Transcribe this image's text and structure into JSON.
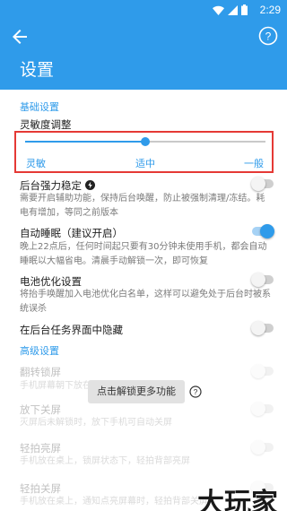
{
  "status_bar": {
    "time": "2:29",
    "icons": [
      "wifi-icon",
      "signal-icon",
      "battery-icon"
    ]
  },
  "app_bar": {
    "title": "设置",
    "back_icon": "arrow-back-icon",
    "help_icon": "help-circle-icon"
  },
  "basic_section": {
    "title": "基础设置",
    "sensitivity": {
      "title": "灵敏度调整",
      "labels": [
        "灵敏",
        "适中",
        "一般"
      ],
      "value_fraction": 0.5
    },
    "rows": [
      {
        "title": "后台强力稳定",
        "badge_icon": "bolt-icon",
        "desc": "需要开启辅助功能，保持后台唤醒，防止被强制清理/冻结。耗电有增加，等同之前版本",
        "enabled": false
      },
      {
        "title": "自动睡眠（建议开启）",
        "desc": "晚上22点后，任何时间起只要有30分钟未使用手机，都会自动睡眠以大幅省电。清晨手动解锁一次，即可恢复",
        "enabled": true
      },
      {
        "title": "电池优化设置",
        "desc": "将抬手唤醒加入电池优化白名单，这样可以避免处于后台时被系统误杀",
        "enabled": false
      },
      {
        "title": "在后台任务界面中隐藏",
        "enabled": false
      }
    ]
  },
  "advanced_section": {
    "title": "高级设置",
    "rows": [
      {
        "title": "翻转锁屏",
        "desc": "手机屏幕朝下放在桌面上时锁屏（省电）",
        "enabled": false
      },
      {
        "title": "放下关屏",
        "desc": "灭屏后未解锁时，放下手机可自动关屏",
        "enabled": false
      },
      {
        "title": "轻拍亮屏",
        "desc": "手机放在桌上，锁屏状态下，轻拍背部亮屏",
        "enabled": false
      },
      {
        "title": "轻拍关屏",
        "desc": "手机放在桌上，通知点亮屏幕时，轻拍背部关屏",
        "enabled": false
      }
    ],
    "unlock_label": "点击解锁更多功能"
  },
  "watermark": "大玩家",
  "colors": {
    "primary": "#2f9bea",
    "highlight_border": "#e53935"
  }
}
